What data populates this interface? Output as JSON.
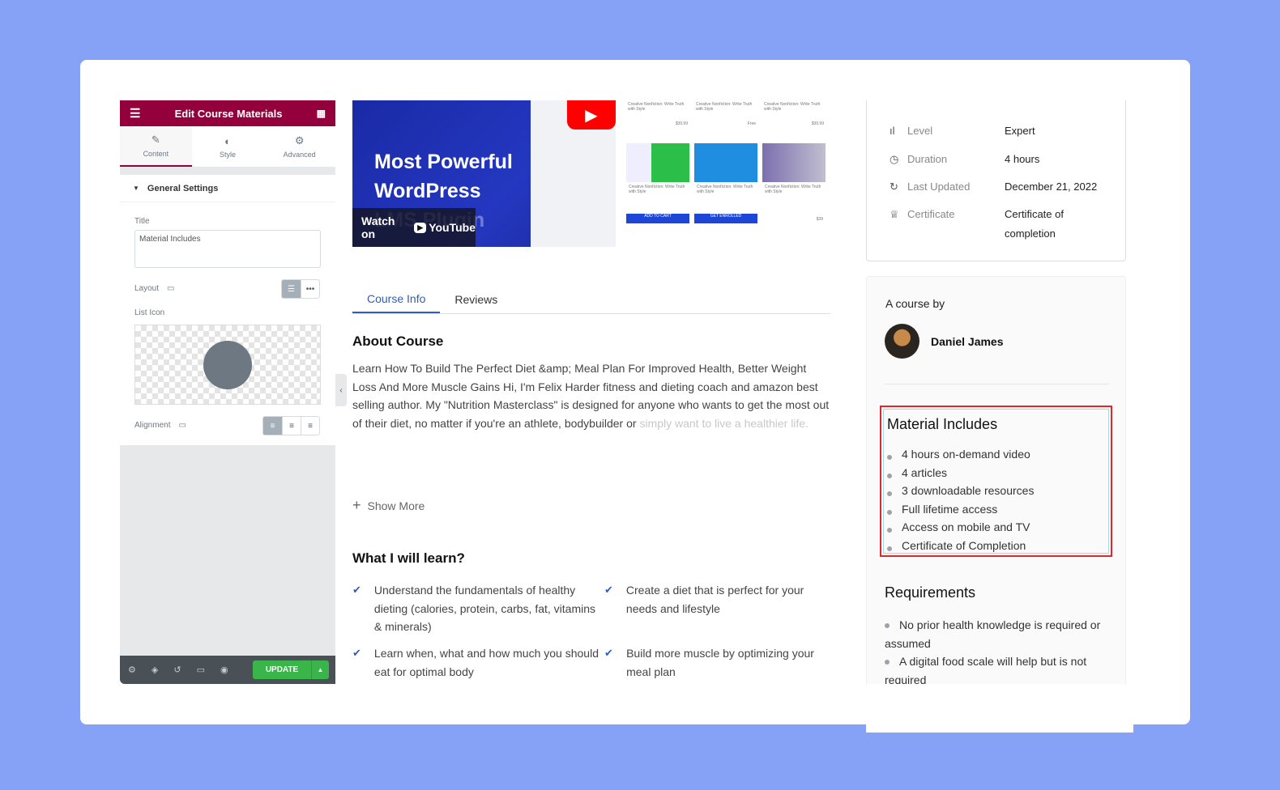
{
  "editor": {
    "title": "Edit Course Materials",
    "tabs": [
      {
        "label": "Content",
        "icon": "pencil-icon"
      },
      {
        "label": "Style",
        "icon": "half-circle-icon"
      },
      {
        "label": "Advanced",
        "icon": "gear-icon"
      }
    ],
    "section": "General Settings",
    "title_label": "Title",
    "title_value": "Material Includes",
    "layout_label": "Layout",
    "list_icon_label": "List Icon",
    "alignment_label": "Alignment",
    "update_label": "UPDATE",
    "accent": "#93003c"
  },
  "video": {
    "title_line1": "Most Powerful",
    "title_line2": "WordPress",
    "subtitle": "LMS Plugin",
    "watch_on": "Watch on",
    "youtube": "YouTube"
  },
  "thumbs": {
    "card_title": "Creative Nonfiction: Write Truth with Style",
    "prices": [
      "$39.99",
      "Free",
      "$39.99"
    ],
    "buttons": [
      "ADD TO CART",
      "GET ENROLLED"
    ],
    "price3": "$39"
  },
  "tabs": [
    {
      "label": "Course Info"
    },
    {
      "label": "Reviews"
    }
  ],
  "about": {
    "heading": "About Course",
    "text": "Learn How To Build The Perfect Diet &amp; Meal Plan For Improved Health, Better Weight Loss And More Muscle Gains Hi, I'm Felix Harder fitness and dieting coach and amazon best selling author. My \"Nutrition Masterclass\" is designed for anyone who wants to get the most out of their diet, no matter if you're an athlete, bodybuilder or",
    "faded": "simply want to live a healthier life.",
    "show_more": "Show More"
  },
  "learn": {
    "heading": "What I will learn?",
    "items": [
      "Understand the fundamentals of healthy dieting (calories, protein, carbs, fat, vitamins & minerals)",
      "Create a diet that is perfect for your needs and lifestyle",
      "Learn when, what and how much you should eat for optimal body",
      "Build more muscle by optimizing your meal plan"
    ]
  },
  "info": [
    {
      "icon": "level-icon",
      "label": "Level",
      "value": "Expert"
    },
    {
      "icon": "clock-icon",
      "label": "Duration",
      "value": "4 hours"
    },
    {
      "icon": "refresh-icon",
      "label": "Last Updated",
      "value": "December 21, 2022"
    },
    {
      "icon": "certificate-icon",
      "label": "Certificate",
      "value": "Certificate of completion"
    }
  ],
  "author": {
    "label": "A course by",
    "name": "Daniel James"
  },
  "materials": {
    "title": "Material Includes",
    "items": [
      "4 hours on-demand video",
      "4 articles",
      "3 downloadable resources",
      "Full lifetime access",
      "Access on mobile and TV",
      "Certificate of Completion"
    ]
  },
  "requirements": {
    "title": "Requirements",
    "items": [
      "No prior health knowledge is required or assumed",
      "A digital food scale will help but is not required"
    ]
  }
}
